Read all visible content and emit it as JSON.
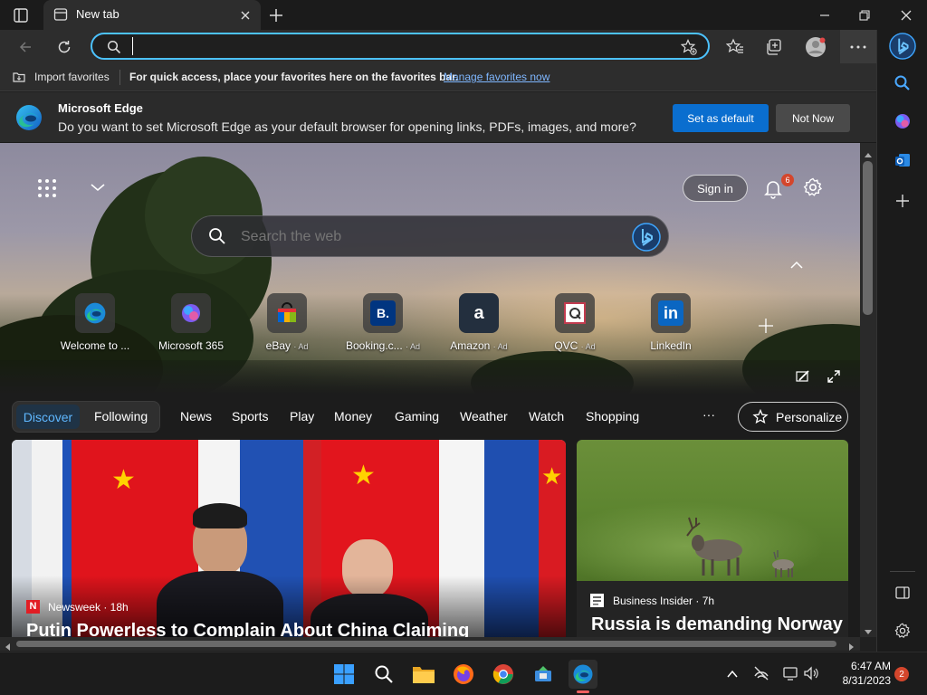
{
  "browser": {
    "tab_title": "New tab",
    "address_value": "",
    "accent": "#4cc2ff"
  },
  "favorites_bar": {
    "import_label": "Import favorites",
    "hint": "For quick access, place your favorites here on the favorites bar.",
    "manage_link": "Manage favorites now"
  },
  "default_prompt": {
    "title": "Microsoft Edge",
    "message": "Do you want to set Microsoft Edge as your default browser for opening links, PDFs, images, and more?",
    "primary": "Set as default",
    "secondary": "Not Now"
  },
  "newtab": {
    "sign_in": "Sign in",
    "notification_count": "6",
    "search_placeholder": "Search the web",
    "quick_links": [
      {
        "label": "Welcome to ...",
        "ad": "",
        "icon": "edge-icon"
      },
      {
        "label": "Microsoft 365",
        "ad": "",
        "icon": "m365-icon"
      },
      {
        "label": "eBay",
        "ad": "· Ad",
        "icon": "ebay-icon"
      },
      {
        "label": "Booking.c...",
        "ad": "· Ad",
        "icon": "booking-icon"
      },
      {
        "label": "Amazon",
        "ad": "· Ad",
        "icon": "amazon-icon"
      },
      {
        "label": "QVC",
        "ad": "· Ad",
        "icon": "qvc-icon"
      },
      {
        "label": "LinkedIn",
        "ad": "",
        "icon": "linkedin-icon"
      }
    ]
  },
  "feed_nav": {
    "discover": "Discover",
    "following": "Following",
    "items": [
      "News",
      "Sports",
      "Play",
      "Money",
      "Gaming",
      "Weather",
      "Watch",
      "Shopping"
    ],
    "more": "···",
    "personalize": "Personalize"
  },
  "cards": [
    {
      "source": "Newsweek · 18h",
      "headline": "Putin Powerless to Complain About China Claiming"
    },
    {
      "source": "Business Insider · 7h",
      "headline": "Russia is demanding Norway"
    }
  ],
  "taskbar": {
    "time": "6:47 AM",
    "date": "8/31/2023",
    "notification_badge": "2"
  }
}
